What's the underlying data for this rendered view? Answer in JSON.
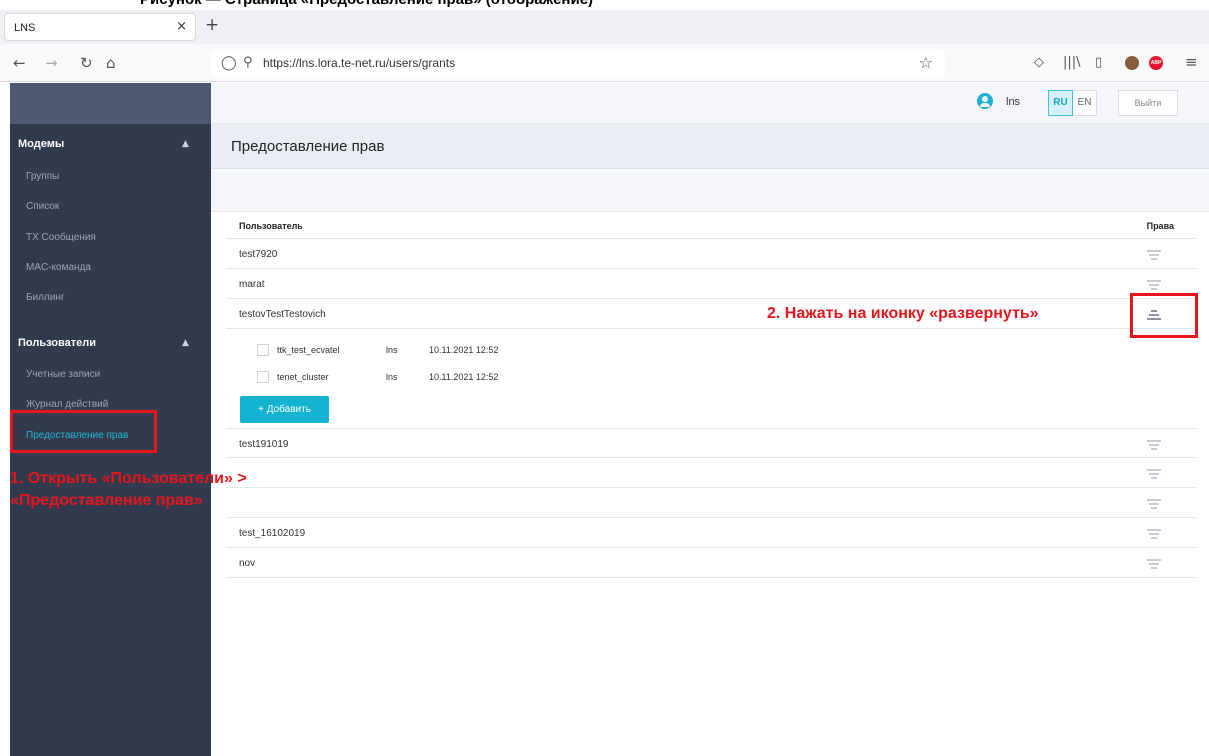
{
  "doc_caption": "Рисунок — Страница «Предоставление прав» (отображение)",
  "browser": {
    "tab_title": "LNS",
    "tab_close": "×",
    "new_tab": "+",
    "url": "https://lns.lora.te-net.ru/users/grants",
    "nav": {
      "back": "←",
      "forward": "→",
      "reload": "↻",
      "home": "⌂"
    },
    "star": "☆",
    "pocket": "◇",
    "library": "|||\\",
    "sidebar_toggle": "▯",
    "menu": "≡",
    "abp": "ABP"
  },
  "header": {
    "user_name": "lns",
    "lang_ru": "RU",
    "lang_en": "EN",
    "logout": "Выйти"
  },
  "sidebar": {
    "sections": [
      {
        "title": "Модемы",
        "caret": "▲",
        "items": [
          "Группы",
          "Список",
          "TX Сообщения",
          "MAC-команда",
          "Биллинг"
        ]
      },
      {
        "title": "Пользователи",
        "caret": "▲",
        "items": [
          "Учетные записи",
          "Журнал действий",
          "Предоставление прав"
        ]
      }
    ],
    "active_item": "Предоставление прав"
  },
  "page": {
    "title": "Предоставление прав",
    "table": {
      "col_user": "Пользователь",
      "col_rights": "Права",
      "rows": [
        "test7920",
        "marat",
        "testovTestTestovich",
        "test191019",
        "",
        "",
        "test_16102019",
        "nov"
      ],
      "expanded_row": "testovTestTestovich",
      "grants": [
        {
          "modem": "ttk_test_ecvatel",
          "user": "lns",
          "date": "10.11.2021 12:52"
        },
        {
          "modem": "tenet_cluster",
          "user": "lns",
          "date": "10.11.2021 12:52"
        }
      ],
      "add_button": "+ Добавить"
    }
  },
  "annotations": {
    "step1_line1": "1. Открыть «Пользователи» >",
    "step1_line2": "«Предоставление прав»",
    "step2": "2. Нажать на иконку «развернуть»",
    "color": "#e8141c"
  }
}
